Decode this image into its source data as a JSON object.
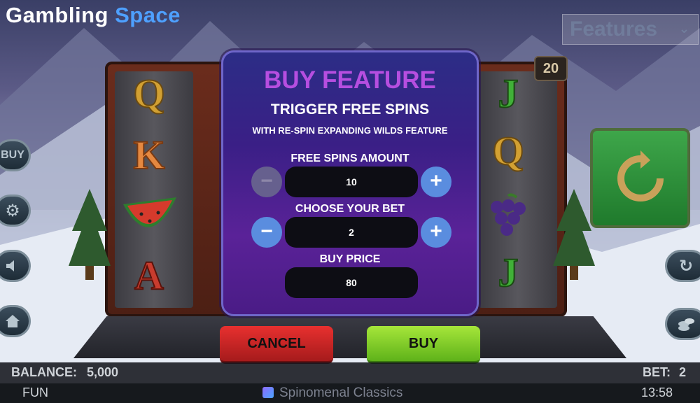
{
  "header": {
    "logo_word1": "Gambling",
    "logo_word2": "Space",
    "features_select": "Features"
  },
  "reels": {
    "counter": "20",
    "col1": [
      "Q",
      "K",
      "watermelon",
      "A"
    ],
    "col5": [
      "J",
      "Q",
      "grapes",
      "J"
    ]
  },
  "side_buttons": {
    "left": [
      "BUY",
      "gear-icon",
      "speaker-icon",
      "home-icon"
    ],
    "right": [
      "refresh-icon",
      "coins-icon"
    ],
    "spin": "spin-icon"
  },
  "modal": {
    "title": "BUY FEATURE",
    "subtitle": "TRIGGER FREE SPINS",
    "description": "WITH RE-SPIN EXPANDING WILDS FEATURE",
    "free_spins_label": "FREE SPINS AMOUNT",
    "free_spins_value": "10",
    "bet_label": "CHOOSE YOUR BET",
    "bet_value": "2",
    "price_label": "BUY PRICE",
    "price_value": "80",
    "minus": "−",
    "plus": "+"
  },
  "actions": {
    "cancel": "CANCEL",
    "buy": "BUY"
  },
  "status": {
    "balance_label": "BALANCE:",
    "balance_value": "5,000",
    "bet_label": "BET:",
    "bet_value": "2",
    "mode": "FUN",
    "brand": "Spinomenal Classics",
    "time": "13:58"
  },
  "colors": {
    "title_purple": "#b64ee0",
    "cancel_red": "#e8302f",
    "buy_green": "#a6e63a",
    "stepper_blue": "#5a8ddf"
  }
}
